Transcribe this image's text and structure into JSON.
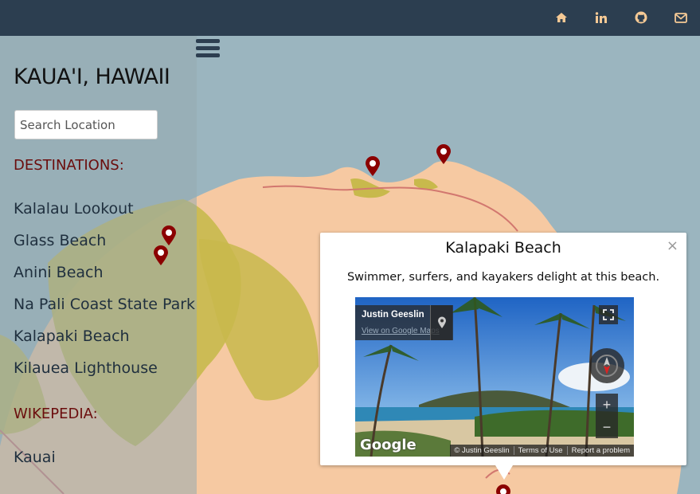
{
  "topbar": {
    "icons": [
      "home-icon",
      "linkedin-icon",
      "github-icon",
      "envelope-icon"
    ],
    "icon_color": "#f5c995"
  },
  "sidebar": {
    "title": "KAUA'I, HAWAII",
    "search": {
      "placeholder": "Search Location",
      "value": ""
    },
    "destinations_heading": "DESTINATIONS:",
    "destinations": [
      "Kalalau Lookout",
      "Glass Beach",
      "Anini Beach",
      "Na Pali Coast State Park",
      "Kalapaki Beach",
      "Kilauea Lighthouse"
    ],
    "wikipedia_heading": "WIKEPEDIA:",
    "wikipedia_links": [
      "Kauai"
    ]
  },
  "map": {
    "colors": {
      "water": "#9bb5bf",
      "land": "#f6c9a2",
      "forest": "#c8b94c",
      "road": "#d2776f",
      "marker": "#8b0000"
    }
  },
  "infowindow": {
    "title": "Kalapaki Beach",
    "description": "Swimmer, surfers, and kayakers delight at this beach.",
    "close": "×",
    "streetview": {
      "author": "Justin Geeslin",
      "view_link": "View on Google Maps",
      "logo": "Google",
      "footer": [
        "© Justin Geeslin",
        "Terms of Use",
        "Report a problem"
      ],
      "zoom_in": "+",
      "zoom_out": "−"
    }
  }
}
